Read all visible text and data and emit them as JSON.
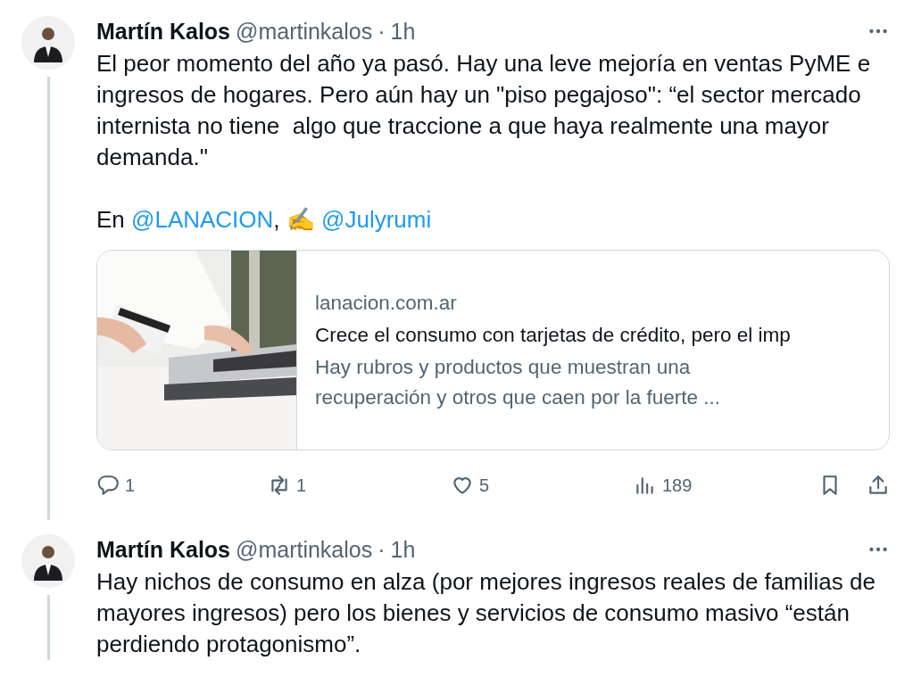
{
  "tweets": [
    {
      "name": "Martín Kalos",
      "handle": "@martinkalos",
      "separator": "·",
      "time": "1h",
      "thread_line": true,
      "paragraphs": [
        [
          {
            "kind": "text",
            "text": "El peor momento del año ya pasó. Hay una leve mejoría en ventas PyME e ingresos de hogares. Pero aún hay un \"piso pegajoso\": “el sector mercado internista no tiene  algo que traccione a que haya realmente una mayor demanda.\""
          }
        ],
        [
          {
            "kind": "text",
            "text": "En "
          },
          {
            "kind": "mention",
            "text": "@LANACION"
          },
          {
            "kind": "text",
            "text": ", ✍️ "
          },
          {
            "kind": "mention",
            "text": "@Julyrumi"
          }
        ]
      ],
      "card": {
        "kind": "picture",
        "domain": "lanacion.com.ar",
        "title": "Crece el consumo con tarjetas de crédito, pero el imp",
        "description": "Hay rubros y productos que muestran una recuperación y otros que caen por la fuerte ..."
      },
      "actions": {
        "replies": "1",
        "reposts": "1",
        "likes": "5",
        "views": "189"
      }
    },
    {
      "name": "Martín Kalos",
      "handle": "@martinkalos",
      "separator": "·",
      "time": "1h",
      "thread_line": true,
      "paragraphs": [
        [
          {
            "kind": "text",
            "text": "Hay nichos de consumo en alza (por mejores ingresos reales de familias de mayores ingresos) pero los bienes y servicios de consumo masivo “están perdiendo protagonismo”."
          }
        ]
      ]
    }
  ]
}
